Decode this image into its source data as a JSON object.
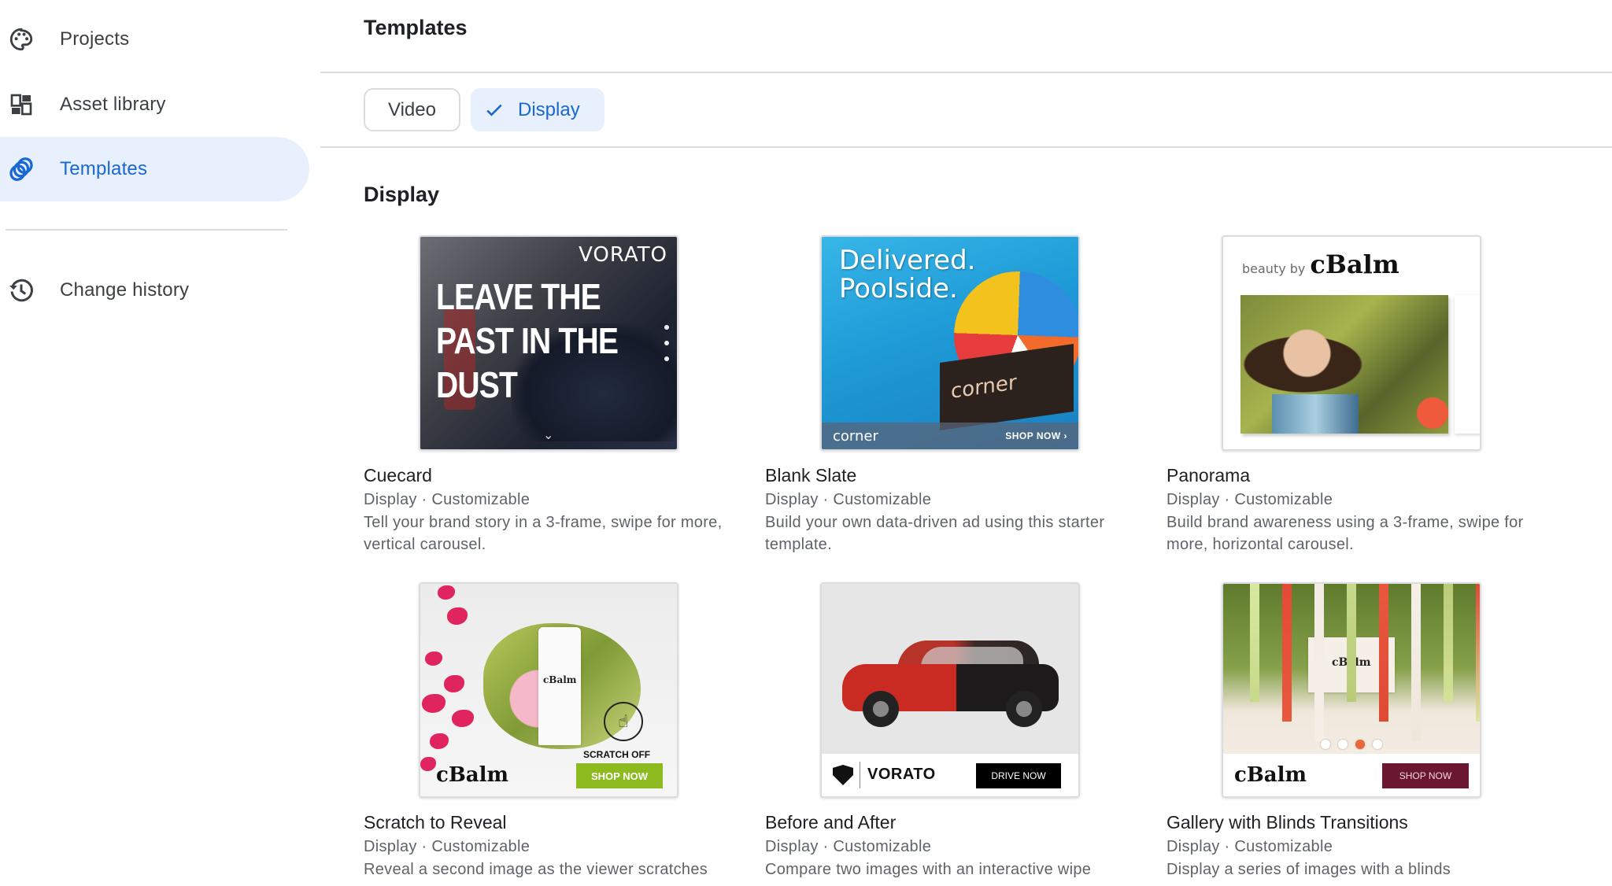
{
  "sidebar": {
    "items": [
      {
        "label": "Projects",
        "icon": "palette-icon",
        "active": false
      },
      {
        "label": "Asset library",
        "icon": "dashboard-icon",
        "active": false
      },
      {
        "label": "Templates",
        "icon": "templates-rings-icon",
        "active": true
      },
      {
        "label": "Change history",
        "icon": "history-icon",
        "active": false
      }
    ]
  },
  "header": {
    "title": "Templates"
  },
  "filters": {
    "chips": [
      {
        "label": "Video",
        "selected": false
      },
      {
        "label": "Display",
        "selected": true,
        "icon": "check-icon"
      }
    ]
  },
  "section": {
    "title": "Display"
  },
  "cards": [
    {
      "title": "Cuecard",
      "meta": "Display · Customizable",
      "description": "Tell your brand story in a 3-frame, swipe for more, vertical carousel.",
      "thumbnail": {
        "brand": "VORATO",
        "headline_lines": [
          "LEAVE THE",
          "PAST IN THE",
          "DUST"
        ]
      }
    },
    {
      "title": "Blank Slate",
      "meta": "Display · Customizable",
      "description": "Build your own data-driven ad using this starter template.",
      "thumbnail": {
        "headline_lines": [
          "Delivered.",
          "Poolside."
        ],
        "box_logo": "corner",
        "bar_logo": "corner",
        "cta": "SHOP NOW ›"
      }
    },
    {
      "title": "Panorama",
      "meta": "Display · Customizable",
      "description": "Build brand awareness using a 3-frame, swipe for more, horizontal carousel.",
      "thumbnail": {
        "brand_prefix": "beauty by",
        "brand": "cBalm"
      }
    },
    {
      "title": "Scratch to Reveal",
      "meta": "Display · Customizable",
      "description": "Reveal a second image as the viewer scratches",
      "thumbnail": {
        "tube_label": "cBalm",
        "hint": "SCRATCH OFF",
        "brand": "cBalm",
        "cta": "SHOP NOW"
      }
    },
    {
      "title": "Before and After",
      "meta": "Display · Customizable",
      "description": "Compare two images with an interactive wipe",
      "thumbnail": {
        "brand": "VORATO",
        "cta": "DRIVE NOW"
      }
    },
    {
      "title": "Gallery with Blinds Transitions",
      "meta": "Display · Customizable",
      "description": "Display a series of images with a blinds",
      "thumbnail": {
        "product_label": "cBalm",
        "brand": "cBalm",
        "cta": "SHOP NOW",
        "carousel_total": 4,
        "carousel_active": 3
      }
    }
  ],
  "colors": {
    "accent": "#1967d2",
    "active_bg": "#e8f0fe",
    "divider": "#dadce0",
    "text_primary": "#202124",
    "text_secondary": "#5f6368"
  }
}
